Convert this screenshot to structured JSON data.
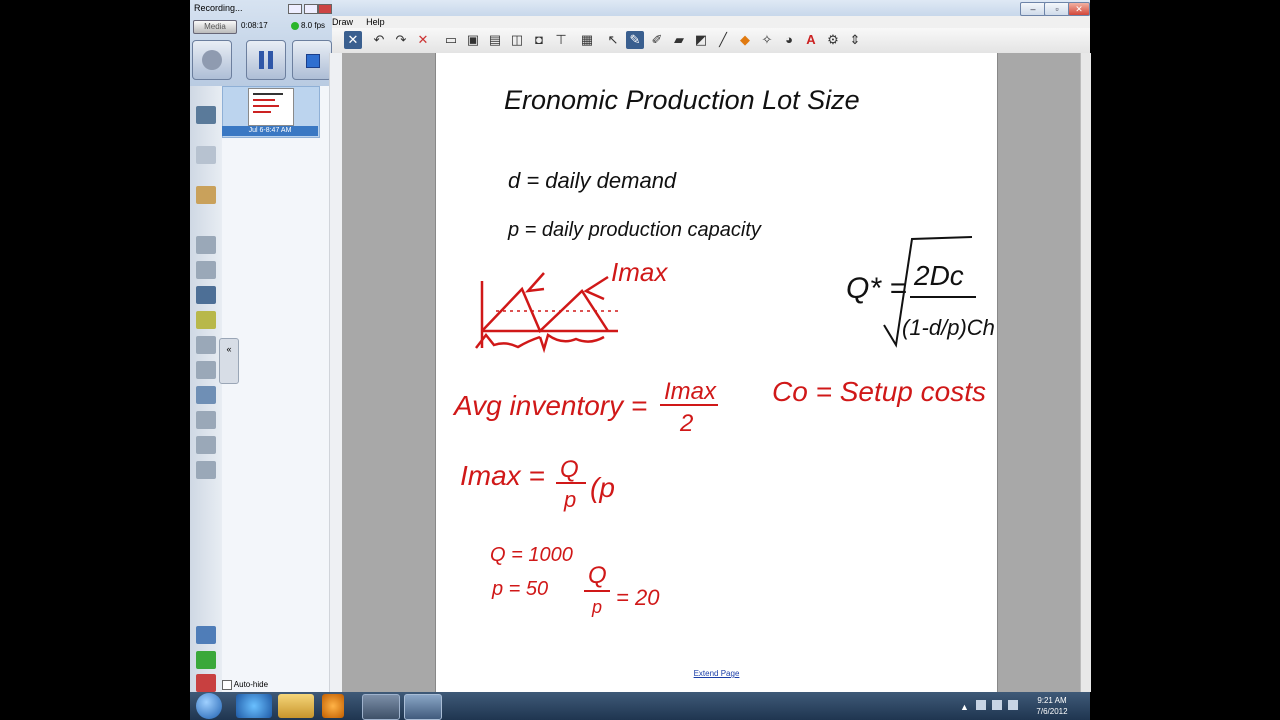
{
  "recorder": {
    "title": "Recording...",
    "elapsed": "0:08:17",
    "fps": "8.0 fps",
    "media_label": "Media"
  },
  "menu": {
    "items": [
      "Draw",
      "Help"
    ]
  },
  "thumbnail": {
    "date": "Jul 6-8:47 AM"
  },
  "sidebar": {
    "autohide_label": "Auto-hide"
  },
  "page": {
    "extend_link": "Extend Page",
    "notes": {
      "title": "Eronomic Production Lot Size",
      "line_d": "d = daily demand",
      "line_p": "p = daily production capacity",
      "imax_label": "Imax",
      "formula_q": "Q* =",
      "formula_num": "2Dc",
      "formula_den": "(1-d/p)Ch",
      "avg_inventory": "Avg inventory =",
      "avg_num": "Imax",
      "avg_den": "2",
      "setup_costs": "Co = Setup costs",
      "imax_eq": "Imax =",
      "imax_num": "Q",
      "imax_den": "p",
      "imax_tail": "(p",
      "q_value": "Q = 1000",
      "p_value": "p = 50",
      "qp_num": "Q",
      "qp_den": "p",
      "qp_result": "= 20"
    }
  },
  "taskbar": {
    "time": "9:21 AM",
    "date": "7/6/2012"
  },
  "colors": {
    "ink_black": "#111111",
    "ink_red": "#d01818",
    "accent_blue": "#3a78c3"
  }
}
